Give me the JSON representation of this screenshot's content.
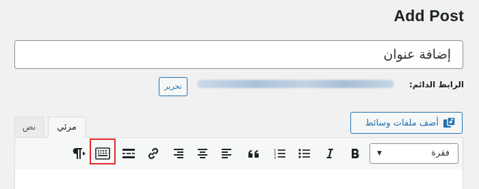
{
  "page": {
    "title": "Add Post"
  },
  "post_title": {
    "placeholder": "إضافة عنوان"
  },
  "permalink": {
    "label": "الرابط الدائم:",
    "edit_label": "تحرير"
  },
  "media": {
    "add_label": "أضف ملفات وسائط"
  },
  "tabs": [
    {
      "label": "مرئي",
      "active": true
    },
    {
      "label": "نص",
      "active": false
    }
  ],
  "toolbar": {
    "format_select": {
      "value": "فقرة"
    },
    "buttons": [
      "bold",
      "italic",
      "bulleted-list",
      "numbered-list",
      "blockquote",
      "align-left",
      "align-center",
      "align-right",
      "insert-link",
      "read-more",
      "toolbar-toggle",
      "paragraph-direction"
    ]
  },
  "colors": {
    "accent": "#2271b1",
    "highlight": "#e32727"
  }
}
